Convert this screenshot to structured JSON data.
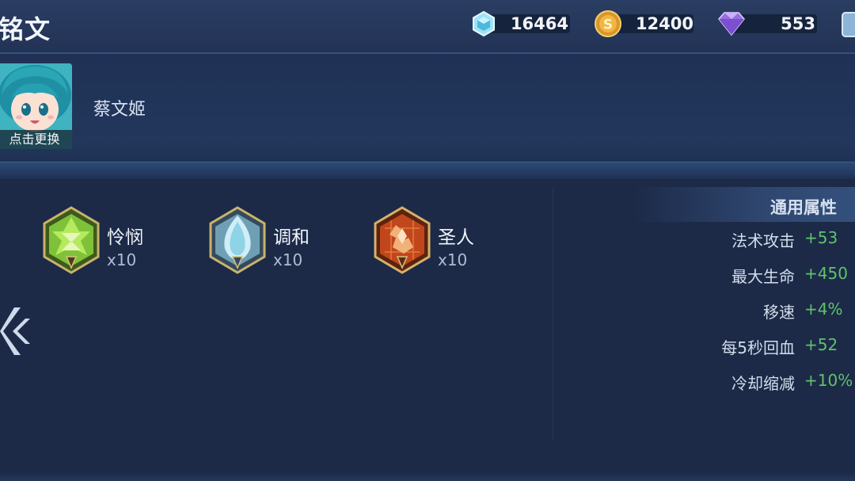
{
  "header": {
    "title": "铭文",
    "currencies": [
      {
        "icon": "crystal-icon",
        "value": "16464"
      },
      {
        "icon": "gold-coin-icon",
        "value": "12400"
      },
      {
        "icon": "diamond-icon",
        "value": "553"
      }
    ]
  },
  "hero": {
    "avatar_caption": "点击更换",
    "name": "蔡文姬"
  },
  "runes": [
    {
      "name": "怜悯",
      "count": "x10",
      "icon": "green-rune-icon",
      "color": "#7fc23a"
    },
    {
      "name": "调和",
      "count": "x10",
      "icon": "blue-rune-icon",
      "color": "#8fd3e6"
    },
    {
      "name": "圣人",
      "count": "x10",
      "icon": "red-rune-icon",
      "color": "#c2461c"
    }
  ],
  "attributes": {
    "title": "通用属性",
    "items": [
      {
        "name": "法术攻击",
        "value": "+53"
      },
      {
        "name": "最大生命",
        "value": "+450"
      },
      {
        "name": "移速",
        "value": "+4%"
      },
      {
        "name": "每5秒回血",
        "value": "+52"
      },
      {
        "name": "冷却缩减",
        "value": "+10%"
      }
    ]
  },
  "colors": {
    "background": "#1b2a48",
    "attribute_value": "#5fc36a"
  }
}
